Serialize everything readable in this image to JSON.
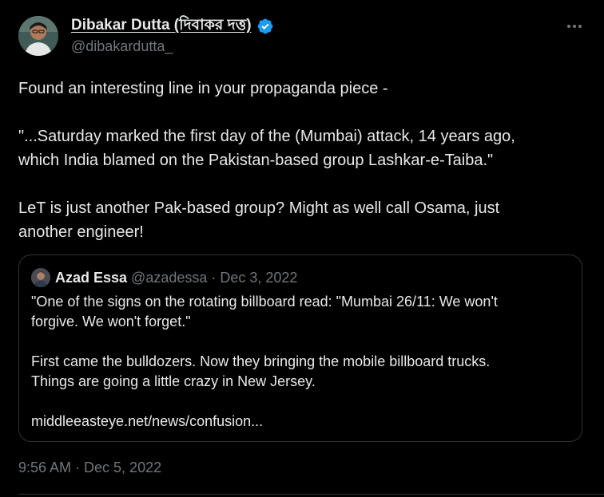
{
  "author": {
    "display_name": "Dibakar Dutta (দিবাকর দত্ত)",
    "handle": "@dibakardutta_",
    "verified": true,
    "verified_icon": "verified-badge-icon",
    "accent_color": "#1d9bf0"
  },
  "more_icon": "more-horizontal-icon",
  "tweet": {
    "paragraphs": [
      "Found an interesting line in your propaganda piece -",
      "\"...Saturday marked the first day of the (Mumbai) attack, 14 years ago,\nwhich India blamed on the Pakistan-based group Lashkar-e-Taiba.\"",
      "LeT is just another Pak-based group? Might as well call Osama, just\nanother engineer!"
    ],
    "timestamp": "9:56 AM · Dec 5, 2022"
  },
  "quoted_tweet": {
    "display_name": "Azad Essa",
    "meta": "@azadessa · Dec 3, 2022",
    "paragraphs": [
      "\"One of the signs on the rotating billboard read: \"Mumbai 26/11: We won't\nforgive. We won't forget.\"",
      "First came the bulldozers. Now they bringing the mobile billboard trucks.\nThings are going a little crazy in New Jersey.",
      "middleeasteye.net/news/confusion..."
    ]
  },
  "colors": {
    "background": "#000000",
    "text_primary": "#e7e9ea",
    "text_secondary": "#71767b",
    "border": "#2f3336"
  }
}
